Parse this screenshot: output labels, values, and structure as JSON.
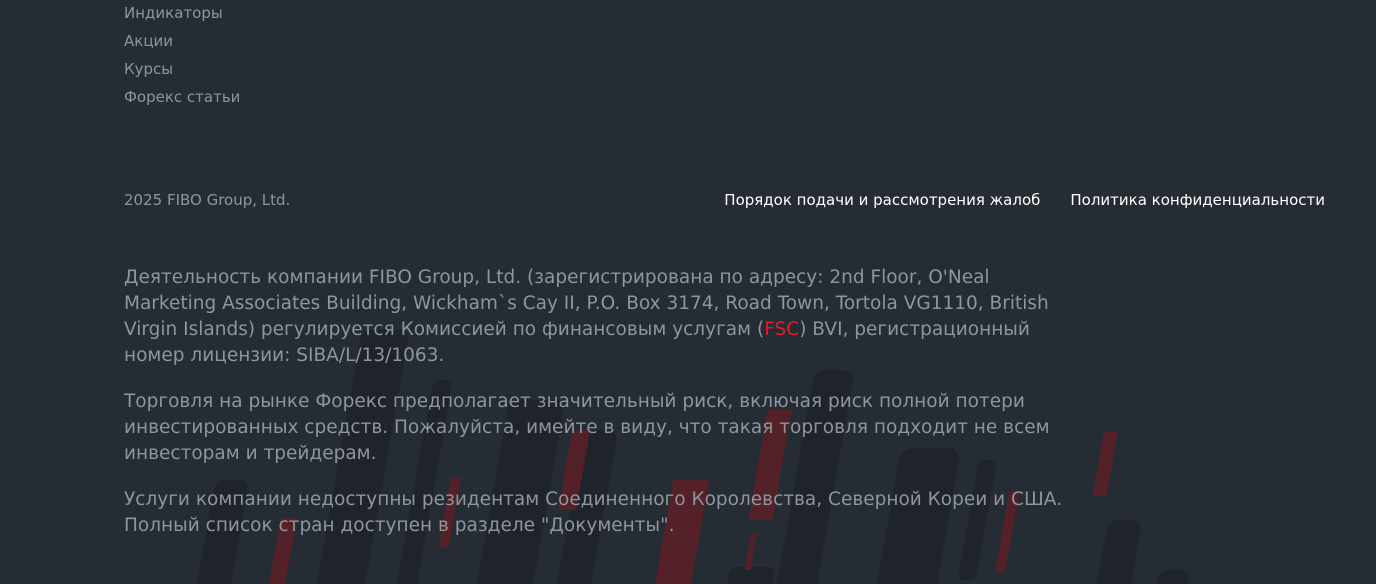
{
  "nav_links": [
    "Индикаторы",
    "Акции",
    "Курсы",
    "Форекс статьи"
  ],
  "footer": {
    "copyright": "2025 FIBO Group, Ltd.",
    "complaints_link": "Порядок подачи и рассмотрения жалоб",
    "privacy_link": "Политика конфиденциальности"
  },
  "disclaimer": {
    "p1_before": "Деятельность компании FIBO Group, Ltd. (зарегистрирована по адресу:  2nd Floor, O'Neal Marketing Associates Building, Wickham`s Cay II, P.O. Box 3174, Road Town, Tortola VG1110, British Virgin Islands) регулируется Комиссией по финансовым услугам (",
    "p1_link": "FSC",
    "p1_after": ") BVI, регистрационный номер лицензии: SIBA/L/13/1063.",
    "p2": "Торговля на рынке Форекс предполагает значительный риск, включая риск полной потери инвестированных средств. Пожалуйста, имейте в виду, что такая торговля подходит не всем инвесторам и трейдерам.",
    "p3": "Услуги компании недоступны резидентам Соединенного Королевства, Северной Кореи и США. Полный список стран доступен в разделе \"Документы\"."
  },
  "colors": {
    "background": "#262c33",
    "muted_text": "#8e959d",
    "link_white": "#ffffff",
    "accent_red": "#e01e2b"
  }
}
